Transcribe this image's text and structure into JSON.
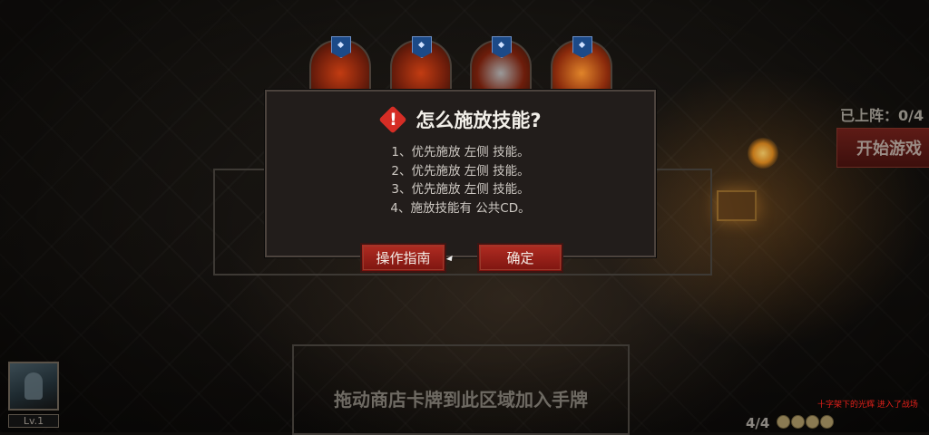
{
  "dialog": {
    "title": "怎么施放技能?",
    "lines": [
      "1、优先施放 左侧 技能。",
      "2、优先施放 左侧 技能。",
      "3、优先施放 左侧 技能。",
      "4、施放技能有 公共CD。"
    ],
    "guide_button": "操作指南",
    "confirm_button": "确定"
  },
  "hud": {
    "deployed_label": "已上阵：0/4",
    "start_button": "开始游戏",
    "hand_zone_hint": "拖动商店卡牌到此区域加入手牌",
    "level": "Lv.1",
    "card_count": "4/4",
    "log_text": "十字架下的光辉 进入了战场"
  },
  "colors": {
    "accent_red": "#b12c22",
    "warning_red": "#d52d25",
    "log_red": "#e0201a"
  },
  "icons": {
    "warning": "warning-diamond-icon",
    "slot_banner": "blue-banner-icon"
  }
}
